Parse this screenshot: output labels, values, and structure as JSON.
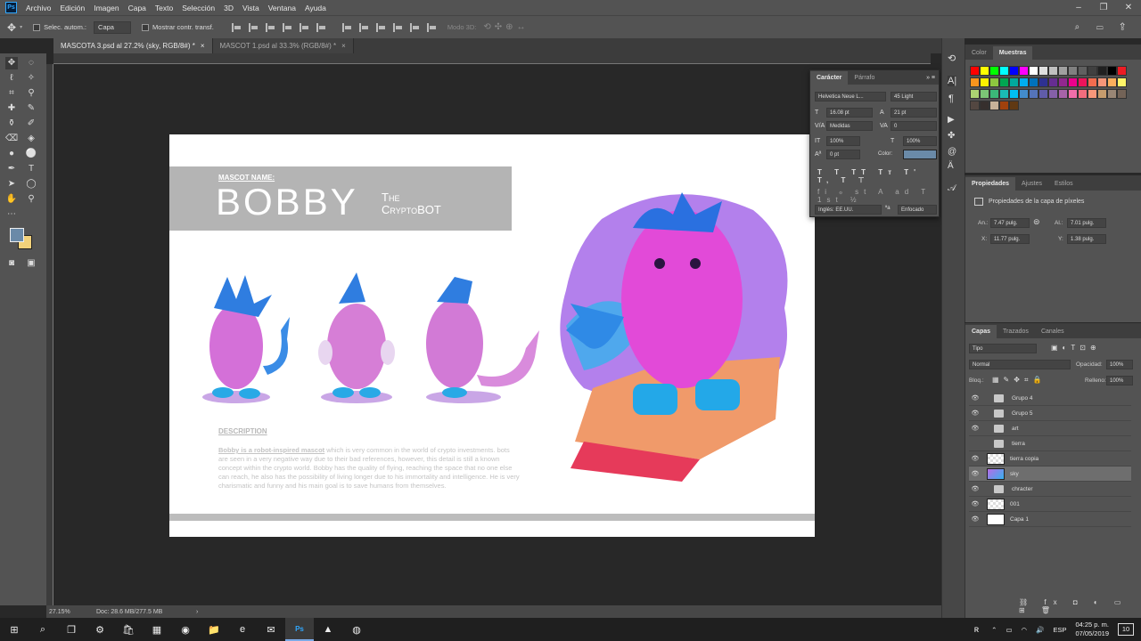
{
  "app": {
    "logo": "Ps"
  },
  "menu": [
    "Archivo",
    "Edición",
    "Imagen",
    "Capa",
    "Texto",
    "Selección",
    "3D",
    "Vista",
    "Ventana",
    "Ayuda"
  ],
  "options": {
    "auto_select_label": "Selec. autom.:",
    "auto_select_value": "Capa",
    "show_transform_label": "Mostrar contr. transf.",
    "mode3d_label": "Modo 3D:"
  },
  "tabs": [
    {
      "label": "MASCOTA 3.psd al 27.2% (sky, RGB/8#) *",
      "active": true
    },
    {
      "label": "MASCOT 1.psd al 33.3% (RGB/8#) *",
      "active": false
    }
  ],
  "status": {
    "zoom": "27.15%",
    "doc": "Doc: 28.6 MB/277.5 MB"
  },
  "document": {
    "name_label": "MASCOT NAME:",
    "name": "BOBBY",
    "sub1": "The",
    "sub2": "CryptoBOT",
    "desc_title": "DESCRIPTION",
    "desc_lead": "Bobby is a robot-inspired mascot",
    "desc_body": " which is very common in the world of crypto investments. bots are seen in a very negative way due to their bad references, however, this detail is still a known concept within the crypto world. Bobby has the quality of flying, reaching the space that no one else can reach, he also has the possibility of living longer due to his immortality and intelligence. He is very charismatic and funny and his main goal is to save humans from themselves."
  },
  "character_panel": {
    "tabs": [
      "Carácter",
      "Párrafo"
    ],
    "font": "Helvetica Neue L...",
    "style": "45 Light",
    "size": "16.08 pt",
    "leading": "21 pt",
    "kerning": "Medidas",
    "tracking": "0",
    "vscale": "100%",
    "hscale": "100%",
    "baseline": "0 pt",
    "color_label": "Color:",
    "color": "#6a8aa8",
    "language": "Inglés: EE.UU.",
    "aa": "Enfocado"
  },
  "swatches_panel": {
    "tabs": [
      "Color",
      "Muestras"
    ],
    "colors": [
      "#ff0000",
      "#ffff00",
      "#00ff00",
      "#00ffff",
      "#0000ff",
      "#ff00ff",
      "#ffffff",
      "#e0e0e0",
      "#c0c0c0",
      "#a0a0a0",
      "#808080",
      "#606060",
      "#404040",
      "#202020",
      "#000000",
      "#ed1c24",
      "#f7941d",
      "#fff200",
      "#8dc63f",
      "#00a651",
      "#00a99d",
      "#00aeef",
      "#0072bc",
      "#2e3192",
      "#662d91",
      "#92278f",
      "#ec008c",
      "#ed145b",
      "#f26c4f",
      "#f69679",
      "#fbaf5d",
      "#fff568",
      "#acd372",
      "#7cc576",
      "#3bb878",
      "#1abbb4",
      "#00bff3",
      "#438ccb",
      "#5574b9",
      "#605ca8",
      "#8560a8",
      "#a763a8",
      "#f06ea9",
      "#f26d7d",
      "#f7977a",
      "#c69c6d",
      "#998675",
      "#736357",
      "#534741",
      "#362f2d",
      "#c7b299",
      "#a0410d",
      "#603913"
    ]
  },
  "properties_panel": {
    "tabs": [
      "Propiedades",
      "Ajustes",
      "Estilos"
    ],
    "title": "Propiedades de la capa de píxeles",
    "w_label": "An.:",
    "w": "7.47 pulg.",
    "h_label": "Al.:",
    "h": "7.01 pulg.",
    "x_label": "X:",
    "x": "11.77 pulg.",
    "y_label": "Y:",
    "y": "1.38 pulg."
  },
  "layers_panel": {
    "tabs": [
      "Capas",
      "Trazados",
      "Canales"
    ],
    "kind": "Tipo",
    "blend": "Normal",
    "opacity_label": "Opacidad:",
    "opacity": "100%",
    "lock_label": "Bloq.:",
    "fill_label": "Relleno:",
    "fill": "100%",
    "layers": [
      {
        "name": "Grupo 4",
        "type": "group",
        "visible": true
      },
      {
        "name": "Grupo 5",
        "type": "group",
        "visible": true
      },
      {
        "name": "art",
        "type": "group",
        "visible": true
      },
      {
        "name": "tierra",
        "type": "group",
        "visible": false
      },
      {
        "name": "tierra copia",
        "type": "pixel",
        "visible": true
      },
      {
        "name": "sky",
        "type": "pixel",
        "visible": true,
        "selected": true
      },
      {
        "name": "chracter",
        "type": "group",
        "visible": true
      },
      {
        "name": "001",
        "type": "pixel",
        "visible": true
      },
      {
        "name": "Capa 1",
        "type": "pixel",
        "visible": true
      }
    ]
  },
  "taskbar": {
    "lang": "ESP",
    "time": "04:25 p. m.",
    "date": "07/05/2019",
    "notif": "10"
  }
}
